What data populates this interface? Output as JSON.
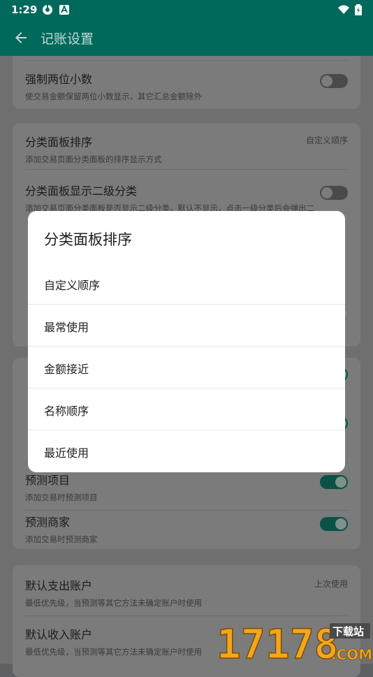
{
  "status_bar": {
    "time": "1:29"
  },
  "app_bar": {
    "title": "记账设置"
  },
  "settings": [
    {
      "title": "强制两位小数",
      "subtitle": "使交易金额保留两位小数显示，其它汇总金额除外"
    },
    {
      "title": "分类面板排序",
      "subtitle": "添加交易页面分类面板的排序显示方式",
      "value": "自定义顺序"
    },
    {
      "title": "分类面板显示二级分类",
      "subtitle": "添加交易页面分类面板是否显示二级分类。默认不显示，点击一级分类后会弹出二"
    },
    {
      "title": "预测项目",
      "subtitle": "添加交易时预测项目"
    },
    {
      "title": "预测商家",
      "subtitle": "添加交易时预测商家"
    },
    {
      "title": "默认支出账户",
      "subtitle": "最低优先级，当预测等其它方法未确定账户时使用",
      "value": "上次使用"
    },
    {
      "title": "默认收入账户",
      "subtitle": "最低优先级，当预测等其它方法未确定账户时使用"
    }
  ],
  "dialog": {
    "title": "分类面板排序",
    "options": [
      "自定义顺序",
      "最常使用",
      "金额接近",
      "名称顺序",
      "最近使用"
    ]
  },
  "watermark": {
    "number": "17178",
    "suffix": ".COM",
    "badge": "下载站"
  }
}
